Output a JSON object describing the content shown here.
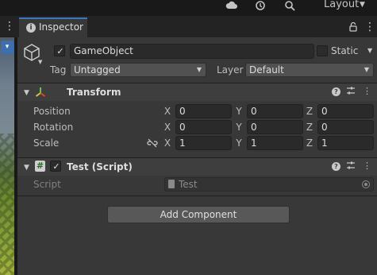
{
  "toolbar": {
    "cloud_icon": "cloud-icon",
    "history_icon": "history-icon",
    "search_icon": "search-icon",
    "layout_label": "Layout"
  },
  "inspector": {
    "tab_title": "Inspector",
    "accent_color": "#3a79bb"
  },
  "gameobject": {
    "active": true,
    "name": "GameObject",
    "static_label": "Static",
    "static": false,
    "tag_label": "Tag",
    "tag_value": "Untagged",
    "layer_label": "Layer",
    "layer_value": "Default"
  },
  "transform": {
    "title": "Transform",
    "position_label": "Position",
    "rotation_label": "Rotation",
    "scale_label": "Scale",
    "axes": {
      "x": "X",
      "y": "Y",
      "z": "Z"
    },
    "position": {
      "x": "0",
      "y": "0",
      "z": "0"
    },
    "rotation": {
      "x": "0",
      "y": "0",
      "z": "0"
    },
    "scale": {
      "x": "1",
      "y": "1",
      "z": "1"
    }
  },
  "script_component": {
    "title": "Test (Script)",
    "enabled": true,
    "script_label": "Script",
    "script_value": "Test"
  },
  "add_component_label": "Add Component"
}
